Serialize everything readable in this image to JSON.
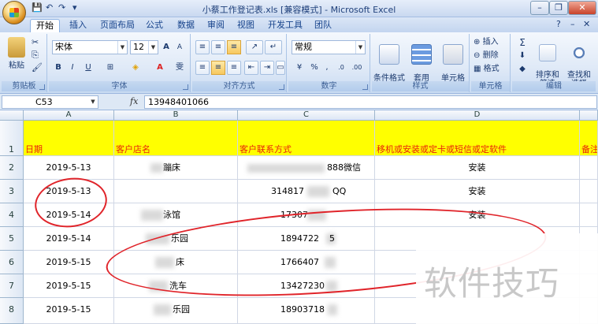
{
  "window": {
    "title": "小蔡工作登记表.xls  [兼容模式] - Microsoft Excel",
    "qat": [
      "save",
      "undo",
      "redo"
    ],
    "buttons": {
      "minimize": "–",
      "restore": "❐",
      "close": "✕"
    }
  },
  "tabs": [
    "开始",
    "插入",
    "页面布局",
    "公式",
    "数据",
    "审阅",
    "视图",
    "开发工具",
    "团队"
  ],
  "ribbon": {
    "clipboard": {
      "label": "剪贴板",
      "paste": "粘贴"
    },
    "font": {
      "label": "字体",
      "name": "宋体",
      "size": "12",
      "grow": "A",
      "shrink": "A",
      "bold": "B",
      "italic": "I",
      "underline": "U"
    },
    "alignment": {
      "label": "对齐方式"
    },
    "number": {
      "label": "数字",
      "format": "常规",
      "percent": "%",
      "comma": ","
    },
    "styles": {
      "label": "样式",
      "conditional": "条件格式",
      "table": "套用\n表格格式",
      "cell": "单元格\n样式"
    },
    "cells": {
      "label": "单元格",
      "insert": "插入",
      "delete": "删除",
      "format": "格式"
    },
    "editing": {
      "label": "编辑",
      "sort": "排序和\n筛选",
      "find": "查找和\n选择"
    }
  },
  "formula_bar": {
    "namebox": "C53",
    "fx": "fx",
    "value": "13948401066"
  },
  "grid": {
    "columns": [
      "A",
      "B",
      "C",
      "D"
    ],
    "rows": [
      "1",
      "2",
      "3",
      "4",
      "5",
      "6",
      "7",
      "8"
    ],
    "headers": {
      "a": "日期",
      "b": "客户店名",
      "c": "客户联系方式",
      "d": "移机或安装或定卡或短信或定软件",
      "e": "备注"
    },
    "data": [
      {
        "a": "2019-5-13",
        "b": "蹦床",
        "c": "888微信",
        "d": "安装"
      },
      {
        "a": "2019-5-13",
        "b": "",
        "c": "314817",
        "c2": "QQ",
        "d": "安装"
      },
      {
        "a": "2019-5-14",
        "b": "泳馆",
        "c": "17307",
        "d": "安装"
      },
      {
        "a": "2019-5-14",
        "b": "乐园",
        "c": "1894722",
        "c2": "5",
        "d": ""
      },
      {
        "a": "2019-5-15",
        "b": "床",
        "c": "1766407",
        "d": ""
      },
      {
        "a": "2019-5-15",
        "b": "洗车",
        "c": "13427230",
        "d": ""
      },
      {
        "a": "2019-5-15",
        "b": "乐园",
        "c": "18903718",
        "d": ""
      }
    ]
  },
  "watermark": "软件技巧",
  "colors": {
    "header_fill": "#ffff00",
    "header_text": "#e8210b",
    "annotation": "#e0242a"
  }
}
